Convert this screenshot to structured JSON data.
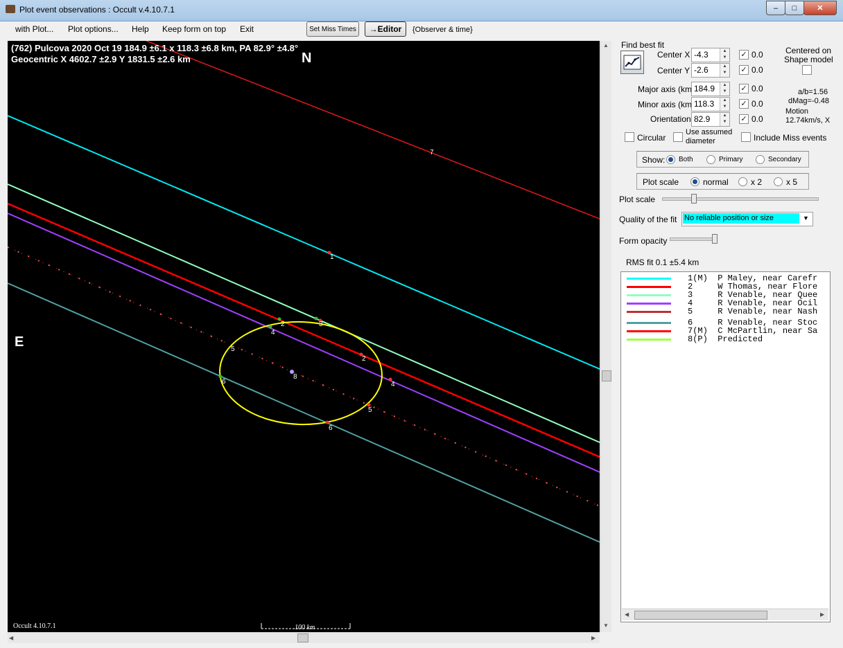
{
  "window": {
    "title": "Plot event observations : Occult v.4.10.7.1"
  },
  "menu": {
    "with_plot": "with Plot...",
    "plot_options": "Plot options...",
    "help": "Help",
    "keep_on_top": "Keep form on top",
    "exit": "Exit"
  },
  "toolbar": {
    "set_miss_times": "Set Miss Times",
    "editor": "→Editor",
    "observer_time": "{Observer & time}"
  },
  "plot": {
    "header1": "(762) Pulcova  2020 Oct 19   184.9 ±6.1 x 118.3 ±6.8 km, PA 82.9° ±4.8°",
    "header2": "Geocentric  X  4602.7 ±2.9  Y 1831.5 ±2.6 km",
    "north": "N",
    "east": "E",
    "footer_version": "Occult 4.10.7.1",
    "scale_label": "100 km",
    "markers": {
      "m1": "1",
      "m2a": "2",
      "m2b": "2",
      "m3": "3",
      "m4a": "4",
      "m4b": "4",
      "m5a": "5",
      "m5b": "5",
      "m6a": "6",
      "m6b": "6",
      "m7": "7",
      "m8": "8"
    }
  },
  "panel": {
    "find_best_fit": "Find best fit",
    "center_x": {
      "label": "Center X",
      "value": "-4.3",
      "fit": "0.0"
    },
    "center_y": {
      "label": "Center Y",
      "value": "-2.6",
      "fit": "0.0"
    },
    "major_axis": {
      "label": "Major axis (km)",
      "value": "184.9",
      "fit": "0.0"
    },
    "minor_axis": {
      "label": "Minor axis (km)",
      "value": "118.3",
      "fit": "0.0"
    },
    "orientation": {
      "label": "Orientation",
      "value": "82.9",
      "fit": "0.0"
    },
    "centered_on": "Centered on",
    "shape_model": "Shape model",
    "ab_ratio": "a/b=1.56",
    "dmag": "dMag=-0.48",
    "motion": "Motion",
    "motion_value": "12.74km/s, X",
    "circular": "Circular",
    "use_assumed_1": "Use assumed",
    "use_assumed_2": "diameter",
    "include_miss": "Include Miss events",
    "show_label": "Show:",
    "show_both": "Both",
    "show_primary": "Primary",
    "show_secondary": "Secondary",
    "plot_scale_group": "Plot scale",
    "scale_normal": "normal",
    "scale_x2": "x 2",
    "scale_x5": "x 5",
    "plot_scale_slider": "Plot scale",
    "quality_label": "Quality of the fit",
    "quality_value": "No reliable position or size",
    "form_opacity": "Form opacity",
    "rms_fit": "RMS fit 0.1 ±5.4 km"
  },
  "legend": [
    {
      "text": "1(M)  P Maley, near Carefr",
      "color": "#00ffff"
    },
    {
      "text": "2     W Thomas, near Flore",
      "color": "#ff0000"
    },
    {
      "text": "3     R Venable, near Quee",
      "color": "#90ffc0"
    },
    {
      "text": "4     R Venable, near Ocil",
      "color": "#a040ff"
    },
    {
      "text": "5     R Venable, near Nash",
      "color": "#c03030"
    },
    {
      "text": "6     R Venable, near Stoc",
      "color": "#50a0a0"
    },
    {
      "text": "7(M)  C McPartlin, near Sa",
      "color": "#ff0000"
    },
    {
      "text": "8(P)  Predicted",
      "color": "#a0ff40"
    }
  ],
  "colors": {
    "plot_bg": "#000000",
    "ellipse": "#ffff00",
    "quality_bg": "#00ffff"
  }
}
